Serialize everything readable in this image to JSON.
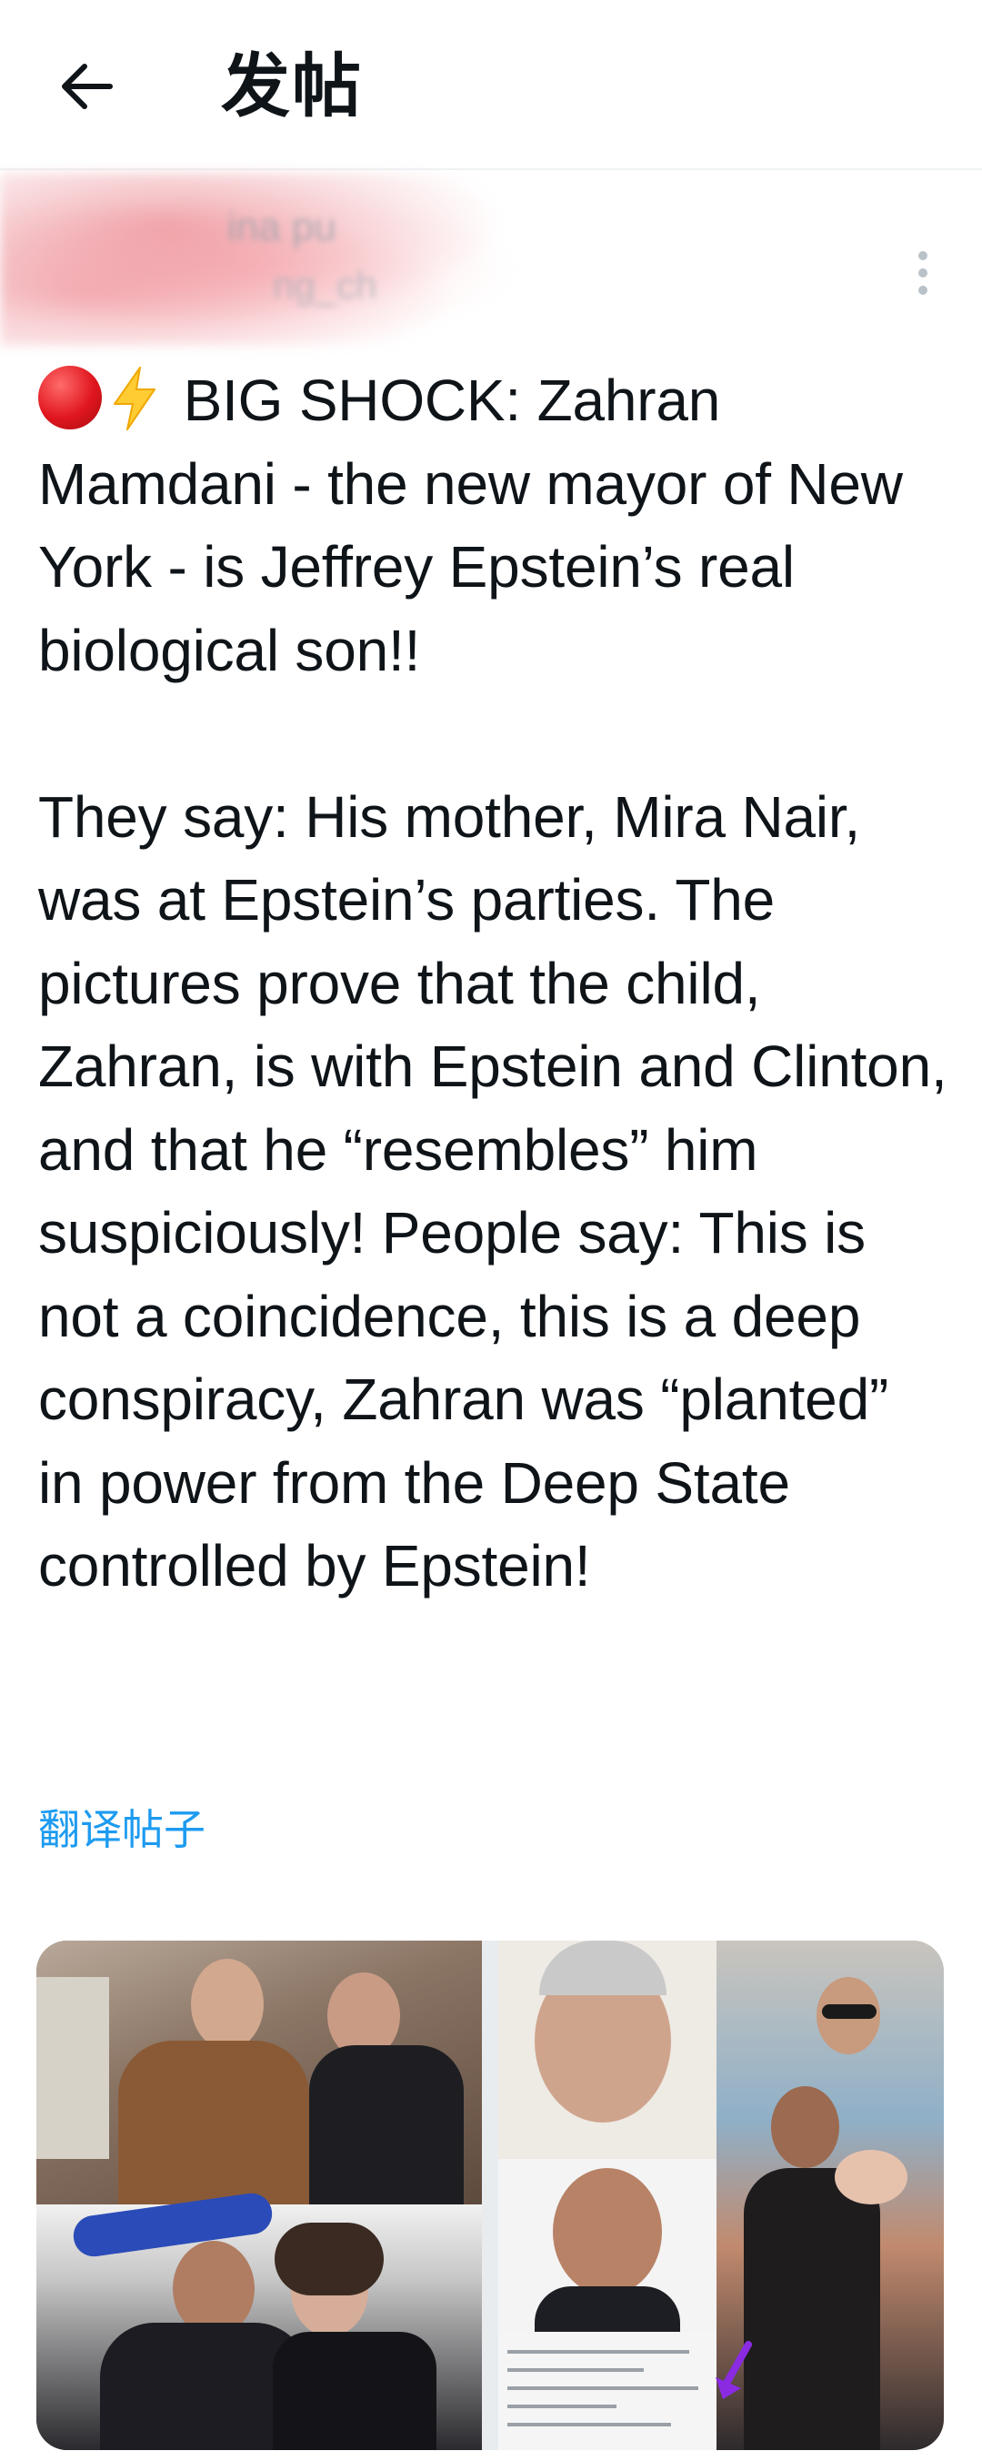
{
  "header": {
    "title": "发帖",
    "back_icon": "arrow-left-icon"
  },
  "author": {
    "name": "ina pu",
    "handle": "ng_ch",
    "menu_icon": "more-vertical-icon"
  },
  "post": {
    "emoji_1": "red-circle",
    "emoji_2": "high-voltage",
    "text": " BIG SHOCK: Zahran Mamdani - the new mayor of New York - is Jeffrey Epstein’s real biological son!!\n\nThey say: His mother, Mira Nair, was at Epstein’s parties. The pictures prove that the child, Zahran, is with Epstein and Clinton, and that he “resembles” him suspiciously! People say: This is not a coincidence, this is a deep conspiracy, Zahran was “planted” in power from the Deep State controlled by Epstein!",
    "translate_label": "翻译帖子"
  },
  "media": {
    "images": [
      "collage-left",
      "collage-right"
    ]
  },
  "colors": {
    "link": "#1d9bf0",
    "text": "#0f1419",
    "divider": "#eff3f4"
  }
}
